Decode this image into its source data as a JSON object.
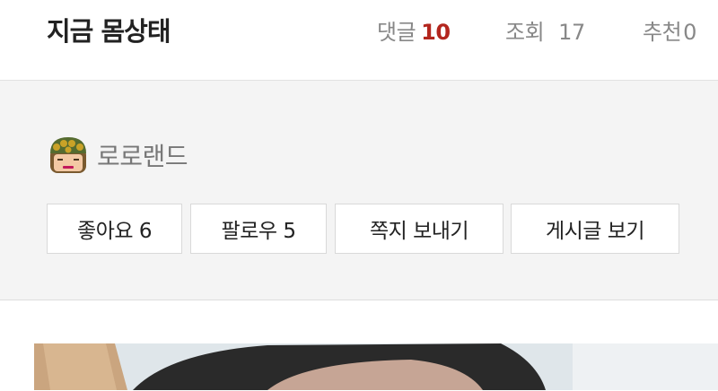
{
  "post": {
    "title": "지금 몸상태"
  },
  "stats": {
    "comments_label": "댓글",
    "comments_count": "10",
    "views_label": "조회",
    "views_count": "17",
    "recommend_label": "추천",
    "recommend_count": "0"
  },
  "author": {
    "nickname": "로로랜드",
    "avatar_icon": "soldier-face-avatar-icon"
  },
  "actions": {
    "like_label": "좋아요 6",
    "follow_label": "팔로우 5",
    "message_label": "쪽지 보내기",
    "posts_label": "게시글 보기"
  },
  "colors": {
    "comment_count": "#b3261e",
    "author_box_bg": "#f4f4f4"
  }
}
